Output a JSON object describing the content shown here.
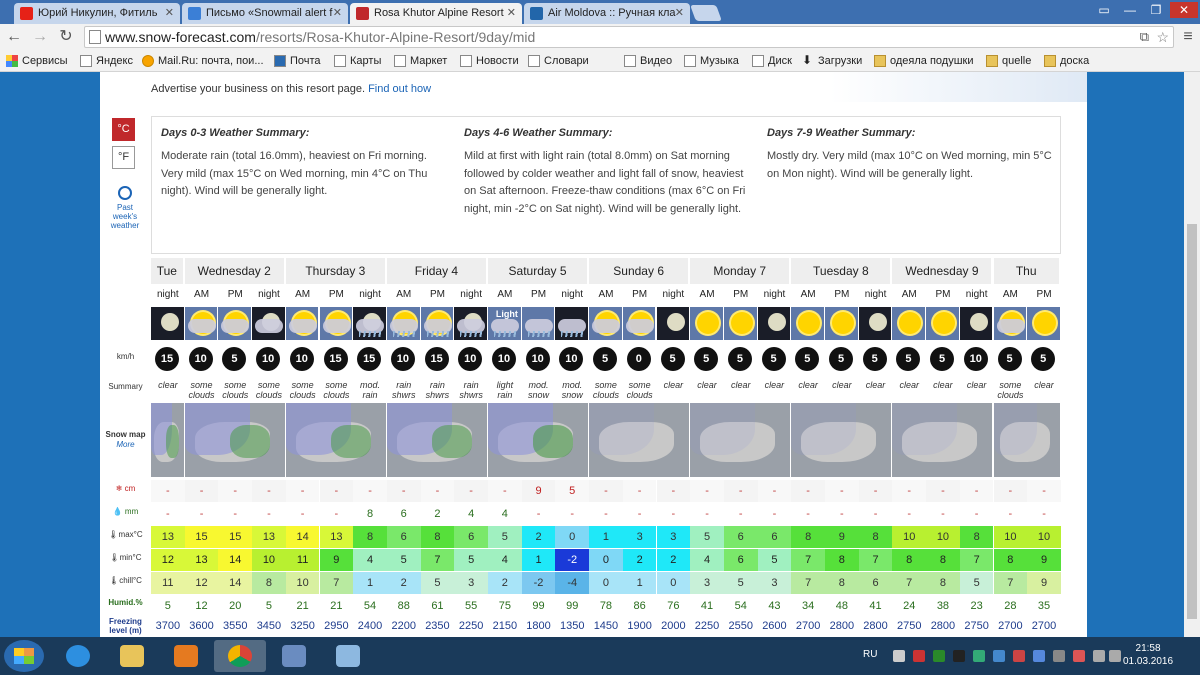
{
  "tabs": [
    {
      "title": "Юрий Никулин, Фитиль",
      "favcolor": "#e62117"
    },
    {
      "title": "Письмо «Snowmail alert f",
      "favcolor": "#3b7fd6"
    },
    {
      "title": "Rosa Khutor Alpine Resort",
      "favcolor": "#c0282b"
    },
    {
      "title": "Air Moldova :: Ручная кла",
      "favcolor": "#2266aa"
    }
  ],
  "url": {
    "host": "www.snow-forecast.com",
    "path": "/resorts/Rosa-Khutor-Alpine-Resort/9day/mid"
  },
  "bookmarks": [
    "Сервисы",
    "Яндекс",
    "Mail.Ru: почта, пои...",
    "Почта",
    "Карты",
    "Маркет",
    "Новости",
    "Словари",
    "Видео",
    "Музыка",
    "Диск",
    "Загрузки",
    "одеяла подушки",
    "quelle",
    "доска"
  ],
  "ad": {
    "text": "Advertise your business on this resort page.",
    "link": "Find out how"
  },
  "units": {
    "celsius": "°C",
    "fahrenheit": "°F"
  },
  "past_weather": "Past week's weather",
  "summaries": [
    {
      "title": "Days 0-3 Weather Summary:",
      "text": "Moderate rain (total 16.0mm), heaviest on Fri morning. Very mild (max 15°C on Wed morning, min 4°C on Thu night). Wind will be generally light."
    },
    {
      "title": "Days 4-6 Weather Summary:",
      "text": "Mild at first with light rain (total 8.0mm) on Sat morning followed by colder weather and light fall of snow, heaviest on Sat afternoon. Freeze-thaw conditions (max 6°C on Fri night, min -2°C on Sat night). Wind will be generally light."
    },
    {
      "title": "Days 7-9 Weather Summary:",
      "text": "Mostly dry. Very mild (max 10°C on Wed morning, min 5°C on Mon night). Wind will be generally light."
    }
  ],
  "row_labels": {
    "wind": "km/h",
    "summary": "Summary",
    "snowmap": "Snow map",
    "snowmap_more": "More",
    "snow": "cm",
    "rain": "mm",
    "max": "max°C",
    "min": "min°C",
    "chill": "chill°C",
    "humid": "Humid.%",
    "freezing": "Freezing level (m)"
  },
  "days": [
    {
      "name": "Tue",
      "periods": 1
    },
    {
      "name": "Wednesday 2",
      "periods": 3
    },
    {
      "name": "Thursday 3",
      "periods": 3
    },
    {
      "name": "Friday 4",
      "periods": 3
    },
    {
      "name": "Saturday 5",
      "periods": 3
    },
    {
      "name": "Sunday 6",
      "periods": 3
    },
    {
      "name": "Monday 7",
      "periods": 3
    },
    {
      "name": "Tuesday 8",
      "periods": 3
    },
    {
      "name": "Wednesday 9",
      "periods": 3
    },
    {
      "name": "Thu",
      "periods": 2
    }
  ],
  "periods": [
    "night",
    "AM",
    "PM",
    "night",
    "AM",
    "PM",
    "night",
    "AM",
    "PM",
    "night",
    "AM",
    "PM",
    "night",
    "AM",
    "PM",
    "night",
    "AM",
    "PM",
    "night",
    "AM",
    "PM",
    "night",
    "AM",
    "PM",
    "night",
    "AM",
    "PM"
  ],
  "icon_overlay_text": "Light",
  "wind": [
    "15",
    "10",
    "5",
    "10",
    "10",
    "15",
    "15",
    "10",
    "15",
    "10",
    "10",
    "10",
    "10",
    "5",
    "0",
    "5",
    "5",
    "5",
    "5",
    "5",
    "5",
    "5",
    "5",
    "5",
    "10",
    "5",
    "5"
  ],
  "summary": [
    "clear",
    "some clouds",
    "some clouds",
    "some clouds",
    "some clouds",
    "some clouds",
    "mod. rain",
    "rain shwrs",
    "rain shwrs",
    "rain shwrs",
    "light rain",
    "mod. snow",
    "mod. snow",
    "some clouds",
    "some clouds",
    "clear",
    "clear",
    "clear",
    "clear",
    "clear",
    "clear",
    "clear",
    "clear",
    "clear",
    "clear",
    "some clouds",
    "clear"
  ],
  "snow": [
    "-",
    "-",
    "-",
    "-",
    "-",
    "-",
    "-",
    "-",
    "-",
    "-",
    "-",
    "9",
    "5",
    "-",
    "-",
    "-",
    "-",
    "-",
    "-",
    "-",
    "-",
    "-",
    "-",
    "-",
    "-",
    "-",
    "-"
  ],
  "rain": [
    "-",
    "-",
    "-",
    "-",
    "-",
    "-",
    "8",
    "6",
    "2",
    "4",
    "4",
    "-",
    "-",
    "-",
    "-",
    "-",
    "-",
    "-",
    "-",
    "-",
    "-",
    "-",
    "-",
    "-",
    "-",
    "-",
    "-"
  ],
  "max": [
    "13",
    "15",
    "15",
    "13",
    "14",
    "13",
    "8",
    "6",
    "8",
    "6",
    "5",
    "2",
    "0",
    "1",
    "3",
    "3",
    "5",
    "6",
    "6",
    "8",
    "9",
    "8",
    "10",
    "10",
    "8",
    "10",
    "10"
  ],
  "min": [
    "12",
    "13",
    "14",
    "10",
    "11",
    "9",
    "4",
    "5",
    "7",
    "5",
    "4",
    "1",
    "-2",
    "0",
    "2",
    "2",
    "4",
    "6",
    "5",
    "7",
    "8",
    "7",
    "8",
    "8",
    "7",
    "8",
    "9"
  ],
  "chill": [
    "11",
    "12",
    "14",
    "8",
    "10",
    "7",
    "1",
    "2",
    "5",
    "3",
    "2",
    "-2",
    "-4",
    "0",
    "1",
    "0",
    "3",
    "5",
    "3",
    "7",
    "8",
    "6",
    "7",
    "8",
    "5",
    "7",
    "9"
  ],
  "humid": [
    "5",
    "12",
    "20",
    "5",
    "21",
    "21",
    "54",
    "88",
    "61",
    "55",
    "75",
    "99",
    "99",
    "78",
    "86",
    "76",
    "41",
    "54",
    "43",
    "34",
    "48",
    "41",
    "24",
    "38",
    "23",
    "28",
    "35"
  ],
  "freezing": [
    "3700",
    "3600",
    "3550",
    "3450",
    "3250",
    "2950",
    "2400",
    "2200",
    "2350",
    "2250",
    "2150",
    "1800",
    "1350",
    "1450",
    "1900",
    "2000",
    "2250",
    "2550",
    "2600",
    "2700",
    "2800",
    "2800",
    "2750",
    "2800",
    "2750",
    "2700",
    "2700"
  ],
  "taskbar": {
    "lang": "RU",
    "time": "21:58",
    "date": "01.03.2016"
  }
}
